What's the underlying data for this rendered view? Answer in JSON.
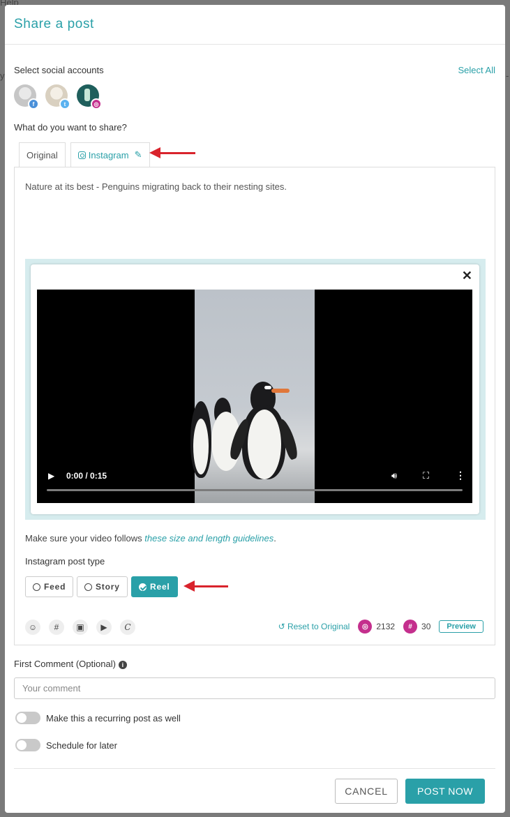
{
  "background": {
    "top_left_text": "Help",
    "left_edge_text": "y",
    "right_edge_text": "-"
  },
  "modal": {
    "title": "Share a post",
    "accounts": {
      "label": "Select social accounts",
      "select_all": "Select All",
      "items": [
        {
          "network": "facebook",
          "icon": "facebook-icon"
        },
        {
          "network": "twitter",
          "icon": "twitter-icon"
        },
        {
          "network": "instagram",
          "icon": "instagram-icon"
        }
      ]
    },
    "share_label": "What do you want to share?",
    "tabs": [
      {
        "label": "Original",
        "active": false
      },
      {
        "label": "Instagram",
        "active": true,
        "icon": "instagram-icon",
        "edit_icon": "pencil-icon"
      }
    ],
    "editor": {
      "text": "Nature at its best - Penguins migrating back to their nesting sites.",
      "video": {
        "time": "0:00 / 0:15",
        "progress": 0
      },
      "guidelines_prefix": "Make sure your video follows ",
      "guidelines_link": "these size and length guidelines",
      "guidelines_suffix": ".",
      "post_type_label": "Instagram post type",
      "post_types": [
        {
          "label": "Feed",
          "selected": false
        },
        {
          "label": "Story",
          "selected": false
        },
        {
          "label": "Reel",
          "selected": true
        }
      ],
      "toolbar_icons": [
        "emoji-icon",
        "hashtag-icon",
        "image-icon",
        "video-icon",
        "canva-icon"
      ],
      "reset_label": "Reset to Original",
      "char_count": "2132",
      "hashtag_count": "30",
      "preview_label": "Preview"
    },
    "first_comment": {
      "label": "First Comment (Optional)",
      "placeholder": "Your comment",
      "value": ""
    },
    "recurring_label": "Make this a recurring post as well",
    "schedule_label": "Schedule for later",
    "cancel_label": "CANCEL",
    "post_label": "POST NOW"
  },
  "colors": {
    "accent": "#2aa0a8",
    "instagram": "#c42f8d",
    "annotation_arrow": "#d9232c"
  }
}
